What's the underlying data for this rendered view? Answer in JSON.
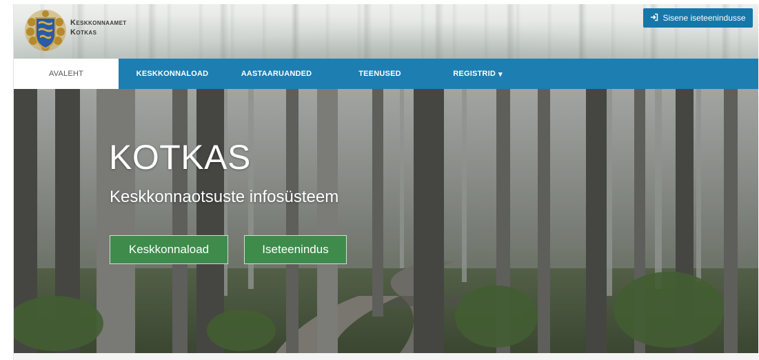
{
  "header": {
    "org_line1": "Keskkonnaamet",
    "org_line2": "Kotkas",
    "login_label": "Sisene iseteenindusse",
    "login_icon": "sign-in-icon"
  },
  "nav": {
    "items": [
      {
        "label": "AVALEHT",
        "active": true
      },
      {
        "label": "KESKKONNALOAD"
      },
      {
        "label": "AASTAARUANDED"
      },
      {
        "label": "TEENUSED"
      },
      {
        "label": "REGISTRID",
        "has_dropdown": true,
        "caret": "▾"
      }
    ]
  },
  "hero": {
    "title": "KOTKAS",
    "subtitle": "Keskkonnaotsuste infosüsteem",
    "buttons": [
      {
        "label": "Keskkonnaload"
      },
      {
        "label": "Iseteenindus"
      }
    ]
  },
  "colors": {
    "nav_bg": "#1d7eb2",
    "login_bg": "#1677a8",
    "hero_button_bg": "#3e8b4b"
  }
}
